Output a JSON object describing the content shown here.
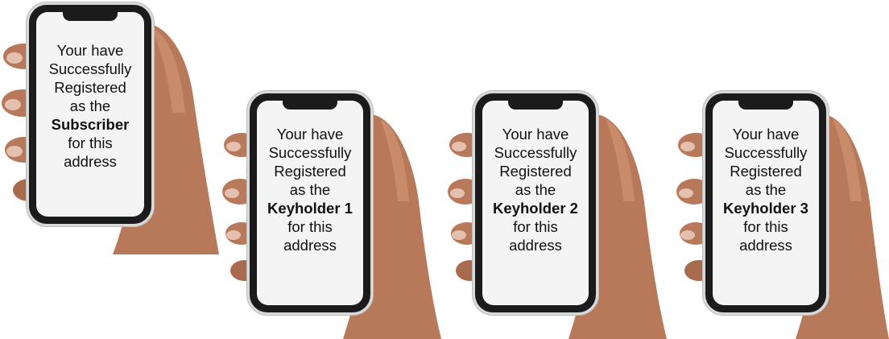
{
  "phones": [
    {
      "line1": "Your have",
      "line2": "Successfully",
      "line3": "Registered",
      "line4": "as the",
      "role": "Subscriber",
      "line6": "for this",
      "line7": "address"
    },
    {
      "line1": "Your have",
      "line2": "Successfully",
      "line3": "Registered",
      "line4": "as the",
      "role": "Keyholder 1",
      "line6": "for this",
      "line7": "address"
    },
    {
      "line1": "Your have",
      "line2": "Successfully",
      "line3": "Registered",
      "line4": "as the",
      "role": "Keyholder 2",
      "line6": "for this",
      "line7": "address"
    },
    {
      "line1": "Your have",
      "line2": "Successfully",
      "line3": "Registered",
      "line4": "as the",
      "role": "Keyholder 3",
      "line6": "for this",
      "line7": "address"
    }
  ],
  "colors": {
    "skin": "#b7795a",
    "skin_shadow": "#8e5638",
    "screen": "#f3f4f3",
    "frame": "#1b1b1b"
  }
}
